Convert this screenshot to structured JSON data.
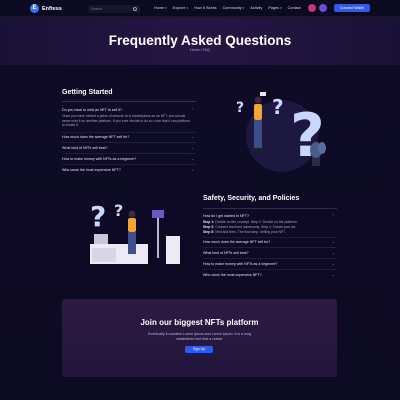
{
  "brand": {
    "name": "Enftess",
    "mark": "E"
  },
  "search": {
    "placeholder": "Search"
  },
  "nav": {
    "items": [
      "Home",
      "Explore",
      "How It Works",
      "Community",
      "Activity",
      "Pages",
      "Contact"
    ]
  },
  "header": {
    "connect_label": "Connect Wallet"
  },
  "hero": {
    "title": "Frequently Asked Questions",
    "breadcrumb": "Home / FAQ"
  },
  "section1": {
    "title": "Getting Started",
    "items": [
      {
        "question": "Do you have to mint an NFT to sell it?",
        "open": true,
        "answer": "Once you have minted a piece of artwork on a marketplace as an NFT, you should never mint it on another platform. If you ever decide to do so, note that it can platform to create it."
      },
      {
        "question": "How much does the average NFT sell for?"
      },
      {
        "question": "What kind of NFTs sell best?"
      },
      {
        "question": "How to make money with NFTs as a beginner?"
      },
      {
        "question": "Who owns the most expensive NFT?"
      }
    ]
  },
  "section2": {
    "title": "Safety, Security, and Policies",
    "items": [
      {
        "question": "How do I get started in NFT?",
        "open": true,
        "steps": [
          {
            "label": "Step 1:",
            "text": "Decide on the concept. Step 2: Decide on the platform."
          },
          {
            "label": "Step 3:",
            "text": "Connect and fund community. Step 4: Create your art."
          },
          {
            "label": "Step 5:",
            "text": "Mint and then. The final step: Selling your NFT."
          }
        ]
      },
      {
        "question": "How much does the average NFT sell for?"
      },
      {
        "question": "What kind of NFTs sell best?"
      },
      {
        "question": "How to make money with NFTs as a beginner?"
      },
      {
        "question": "Who owns the most expensive NFT?"
      }
    ]
  },
  "cta": {
    "title": "Join our biggest NFTs platform",
    "text": "Eventually it contains Lorem ipsum and Lorem ipsum. It is a long established fact that a reader",
    "button": "Sign Up"
  },
  "icons": {
    "search": "search-icon",
    "chevron": "chevron-down-icon",
    "bell": "bell-icon",
    "avatar": "avatar"
  },
  "colors": {
    "accent": "#2f5bea",
    "background": "#0d0a24",
    "cta_bg": "#2c1a43"
  }
}
